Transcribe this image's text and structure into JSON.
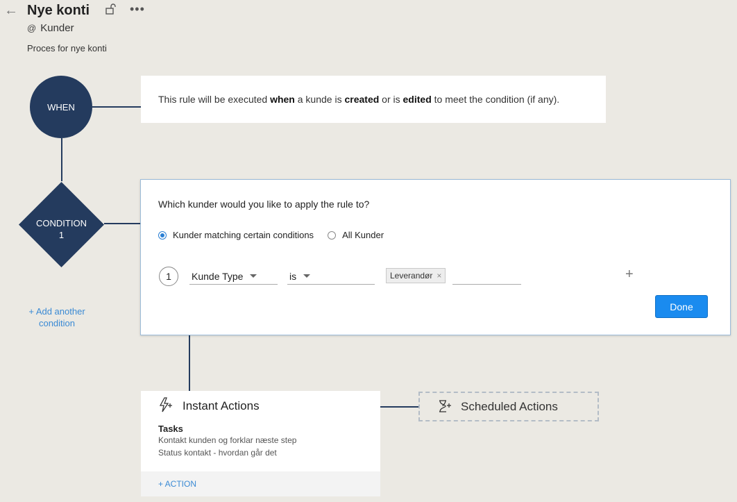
{
  "header": {
    "title": "Nye konti",
    "module_prefix": "@",
    "module": "Kunder",
    "description": "Proces for nye konti"
  },
  "when": {
    "label": "WHEN",
    "text_parts": [
      "This rule will be executed ",
      "when",
      " a kunde is ",
      "created",
      " or is ",
      "edited",
      " to meet the condition (if any)."
    ]
  },
  "condition": {
    "label_line1": "CONDITION",
    "label_line2": "1",
    "add_another": "+ Add another condition",
    "question": "Which kunder would you like to apply the rule to?",
    "radio_options": [
      {
        "label": "Kunder matching certain conditions",
        "selected": true
      },
      {
        "label": "All Kunder",
        "selected": false
      }
    ],
    "rule": {
      "number": "1",
      "field": "Kunde Type",
      "operator": "is",
      "value_tag": "Leverandør",
      "tag_remove": "×"
    },
    "add_rule_symbol": "+",
    "done_button": "Done"
  },
  "instant_actions": {
    "title": "Instant Actions",
    "tasks_label": "Tasks",
    "tasks": [
      "Kontakt kunden og forklar næste step",
      "Status kontakt - hvordan går det"
    ],
    "add_action": "+ ACTION"
  },
  "scheduled_actions": {
    "title": "Scheduled Actions"
  },
  "icons": {
    "back": "back-arrow-icon",
    "lock": "lock-icon",
    "more": "more-options-icon",
    "instant": "lightning-plus-icon",
    "scheduled": "hourglass-plus-icon"
  },
  "colors": {
    "node": "#243b5e",
    "accent": "#1a8bef",
    "link": "#3a8ad4",
    "background": "#ebe9e3"
  }
}
